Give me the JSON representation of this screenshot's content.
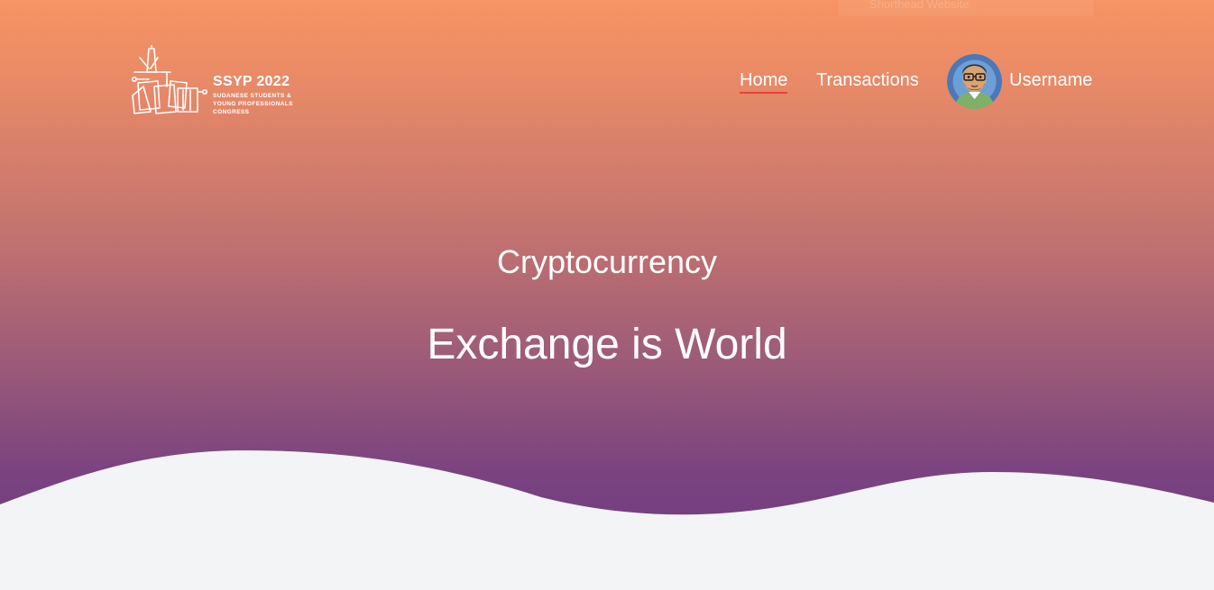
{
  "top_bar": {
    "faded_text": "Shorthead Website"
  },
  "logo": {
    "title": "SSYP 2022",
    "subtitle_line1": "SUDANESE STUDENTS &",
    "subtitle_line2": "YOUNG PROFESSIONALS",
    "subtitle_line3": "CONGRESS"
  },
  "nav": {
    "items": [
      {
        "label": "Home",
        "active": true
      },
      {
        "label": "Transactions",
        "active": false
      }
    ]
  },
  "user": {
    "name": "Username",
    "avatar_icon": "cartoon-man-avatar"
  },
  "hero": {
    "line1": "Cryptocurrency",
    "line2": "Exchange is World"
  },
  "colors": {
    "gradient_top": "#f79463",
    "gradient_bottom": "#6d3a82",
    "active_underline": "#e8413c",
    "page_background": "#f3f4f6"
  }
}
